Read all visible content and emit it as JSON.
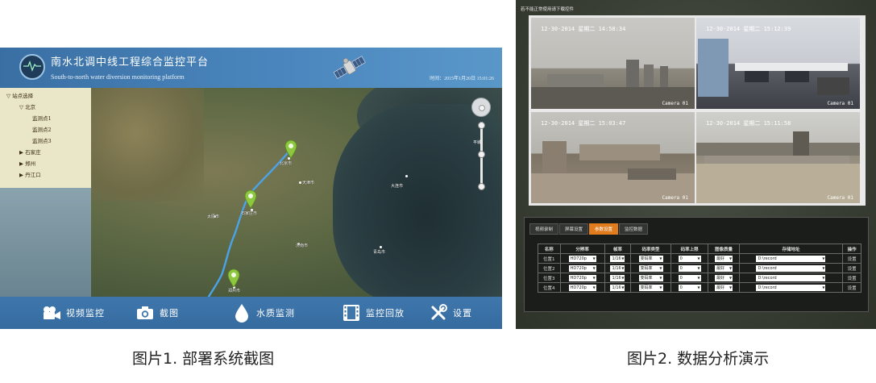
{
  "figure1": {
    "header": {
      "title_cn": "南水北调中线工程综合监控平台",
      "title_en": "South-to-north water diversion monitoring platform",
      "time_label": "时间：2015年1月20日 15:01:26"
    },
    "tree": {
      "root": "▽ 站点选择",
      "beijing": "▽ 北京",
      "points": [
        "监测点1",
        "监测点2",
        "监测点3"
      ],
      "others": [
        "▶ 石家庄",
        "▶ 郑州",
        "▶ 丹江口"
      ]
    },
    "map": {
      "cities": [
        {
          "name": "北京市"
        },
        {
          "name": "天津市"
        },
        {
          "name": "石家庄市"
        },
        {
          "name": "太原市"
        },
        {
          "name": "济南市"
        },
        {
          "name": "郑州市"
        },
        {
          "name": "大连市"
        },
        {
          "name": "青岛市"
        }
      ],
      "zoom_label": "平城"
    },
    "toolbar": [
      {
        "label": "视频监控",
        "icon": "video-camera-icon"
      },
      {
        "label": "截图",
        "icon": "camera-icon"
      },
      {
        "label": "水质监测",
        "icon": "water-drop-icon"
      },
      {
        "label": "监控回放",
        "icon": "film-icon"
      },
      {
        "label": "设置",
        "icon": "tools-icon"
      }
    ],
    "colors": {
      "header": "#4a86bd",
      "toolbar": "#3f77ad",
      "pin": "#8dc63f"
    }
  },
  "figure2": {
    "top_text": "若不能正常使用请下载控件",
    "cameras": [
      {
        "timestamp": "12-30-2014 星期二 14:58:34",
        "label": "Camera 01"
      },
      {
        "timestamp": "12-30-2014 星期二 15:12:39",
        "label": "Camera 01"
      },
      {
        "timestamp": "12-30-2014 星期二 15:03:47",
        "label": "Camera 01"
      },
      {
        "timestamp": "12-30-2014 星期二 15:11:58",
        "label": "Camera 01"
      }
    ],
    "tabs": [
      {
        "label": "视频录制",
        "active": false
      },
      {
        "label": "屏幕设置",
        "active": false
      },
      {
        "label": "参数设置",
        "active": true
      },
      {
        "label": "监控数据",
        "active": false
      }
    ],
    "table": {
      "headers": [
        "名称",
        "分辨率",
        "帧率",
        "码率类型",
        "码率上限",
        "图像质量",
        "存储地址",
        "操作"
      ],
      "rows": [
        {
          "name": "位置1",
          "resolution": "HD720p",
          "fps": "1/16",
          "rate_type": "变码率",
          "rate_max": "0",
          "quality": "最好",
          "path": "D:\\record",
          "action": "设置"
        },
        {
          "name": "位置2",
          "resolution": "HD720p",
          "fps": "1/16",
          "rate_type": "变码率",
          "rate_max": "0",
          "quality": "最好",
          "path": "D:\\record",
          "action": "设置"
        },
        {
          "name": "位置3",
          "resolution": "HD720p",
          "fps": "1/16",
          "rate_type": "变码率",
          "rate_max": "0",
          "quality": "最好",
          "path": "D:\\record",
          "action": "设置"
        },
        {
          "name": "位置4",
          "resolution": "HD720p",
          "fps": "1/16",
          "rate_type": "变码率",
          "rate_max": "0",
          "quality": "最好",
          "path": "D:\\record",
          "action": "设置"
        }
      ]
    },
    "colors": {
      "active_tab": "#e07b1e"
    }
  },
  "captions": {
    "fig1": "图片1. 部署系统截图",
    "fig2": "图片2. 数据分析演示"
  }
}
